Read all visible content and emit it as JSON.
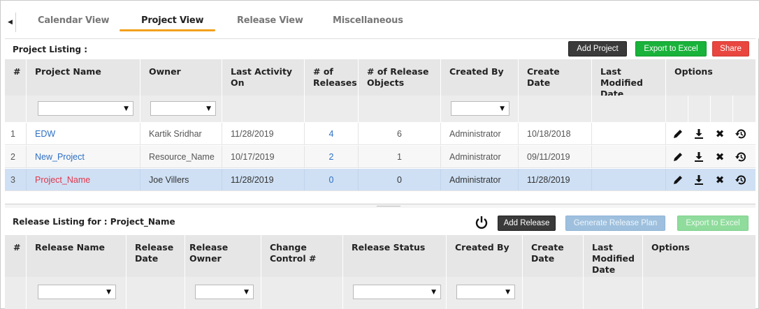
{
  "tabs": [
    {
      "label": "Calendar View",
      "active": false
    },
    {
      "label": "Project View",
      "active": true
    },
    {
      "label": "Release View",
      "active": false
    },
    {
      "label": "Miscellaneous",
      "active": false
    }
  ],
  "project_listing": {
    "title": "Project Listing :",
    "buttons": {
      "add": "Add Project",
      "export": "Export to Excel",
      "share": "Share"
    },
    "columns": [
      "#",
      "Project Name",
      "Owner",
      "Last Activity On",
      "# of Releases",
      "# of Release Objects",
      "Created By",
      "Create Date",
      "Last Modified Date",
      "Options"
    ],
    "rows": [
      {
        "num": "1",
        "name": "EDW",
        "owner": "Kartik Sridhar",
        "last_activity": "11/28/2019",
        "releases": "4",
        "objects": "6",
        "created_by": "Administrator",
        "create_date": "10/18/2018",
        "modified": ""
      },
      {
        "num": "2",
        "name": "New_Project",
        "owner": "Resource_Name",
        "last_activity": "10/17/2019",
        "releases": "2",
        "objects": "1",
        "created_by": "Administrator",
        "create_date": "09/11/2019",
        "modified": ""
      },
      {
        "num": "3",
        "name": "Project_Name",
        "owner": "Joe Villers",
        "last_activity": "11/28/2019",
        "releases": "0",
        "objects": "0",
        "created_by": "Administrator",
        "create_date": "11/28/2019",
        "modified": ""
      }
    ]
  },
  "release_listing": {
    "title": "Release Listing for : Project_Name",
    "buttons": {
      "add": "Add Release",
      "generate": "Generate Release Plan",
      "export": "Export to Excel"
    },
    "columns": [
      "#",
      "Release Name",
      "Release Date",
      "Release Owner",
      "Change Control #",
      "Release Status",
      "Created By",
      "Create Date",
      "Last Modified Date",
      "Options"
    ]
  },
  "icons": {
    "collapse": "triangle-left-icon",
    "edit": "pencil-icon",
    "download": "download-icon",
    "delete": "close-icon",
    "history": "history-icon",
    "power": "power-icon",
    "dropdown": "chevron-down-icon"
  },
  "colors": {
    "accent": "#f3a01b",
    "link": "#2d6fc4",
    "selected_link": "#e0364b",
    "selected_row": "#cfe0f4",
    "header_bg": "#e6e6e6"
  }
}
